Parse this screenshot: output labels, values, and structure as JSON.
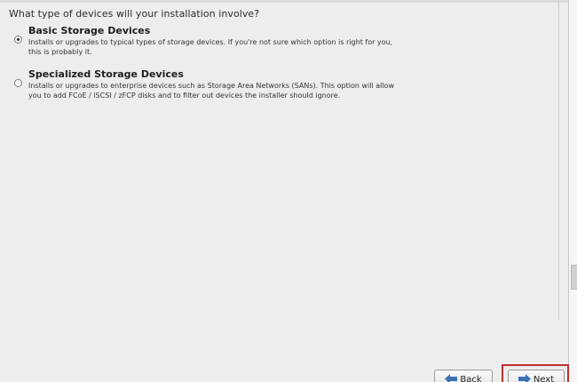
{
  "installer": {
    "question": "What type of devices will your installation involve?",
    "options": [
      {
        "title": "Basic Storage Devices",
        "description_line1": "Installs or upgrades to typical types of storage devices.  If you're not sure which option is right for you,",
        "description_line2": "this is probably it.",
        "selected": true
      },
      {
        "title": "Specialized Storage Devices",
        "description_line1": "Installs or upgrades to enterprise devices such as Storage Area Networks (SANs). This option will allow",
        "description_line2": "you to add FCoE / iSCSI / zFCP disks and to filter out devices the installer should ignore.",
        "selected": false
      }
    ]
  },
  "buttons": {
    "back_label": "Back",
    "next_label": "Next",
    "back_icon": "back-arrow-icon",
    "next_icon": "next-arrow-icon"
  },
  "colors": {
    "highlight_frame": "#c0302f",
    "arrow_blue": "#3b6fb6"
  }
}
